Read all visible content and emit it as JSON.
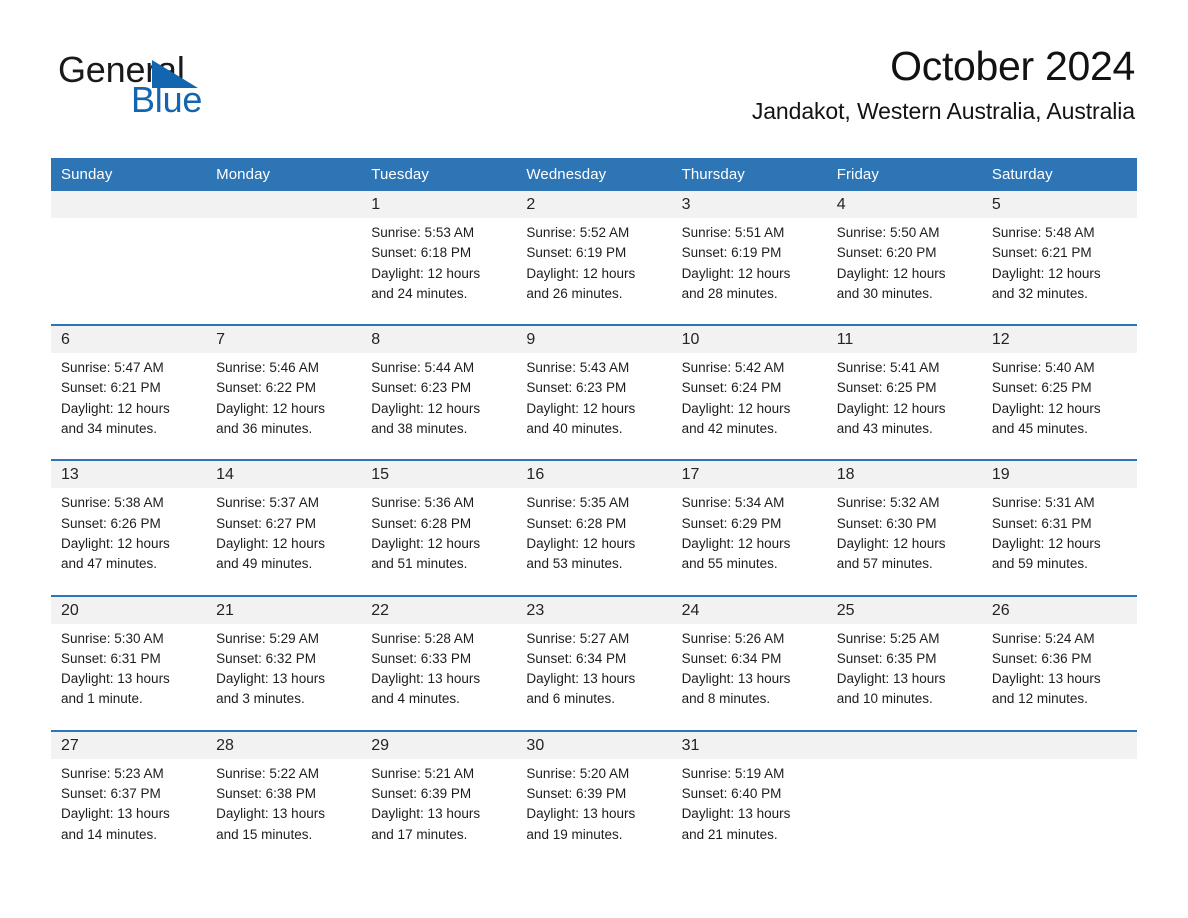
{
  "brand": {
    "name_part1": "General",
    "name_part2": "Blue",
    "triangle_color": "#1266b0",
    "text_color": "#1a1a1a"
  },
  "header": {
    "title": "October 2024",
    "subtitle": "Jandakot, Western Australia, Australia"
  },
  "theme": {
    "header_blue": "#2e75b6",
    "date_band_gray": "#f2f2f2",
    "page_background": "#ffffff",
    "body_text": "#1d1d1d"
  },
  "weekday_headers": [
    "Sunday",
    "Monday",
    "Tuesday",
    "Wednesday",
    "Thursday",
    "Friday",
    "Saturday"
  ],
  "labels": {
    "sunrise_prefix": "Sunrise:",
    "sunset_prefix": "Sunset:",
    "daylight_prefix": "Daylight:"
  },
  "weeks": [
    [
      {
        "day": "",
        "empty": true
      },
      {
        "day": "",
        "empty": true
      },
      {
        "day": "1",
        "sunrise": "Sunrise: 5:53 AM",
        "sunset": "Sunset: 6:18 PM",
        "daylight": "Daylight: 12 hours and 24 minutes."
      },
      {
        "day": "2",
        "sunrise": "Sunrise: 5:52 AM",
        "sunset": "Sunset: 6:19 PM",
        "daylight": "Daylight: 12 hours and 26 minutes."
      },
      {
        "day": "3",
        "sunrise": "Sunrise: 5:51 AM",
        "sunset": "Sunset: 6:19 PM",
        "daylight": "Daylight: 12 hours and 28 minutes."
      },
      {
        "day": "4",
        "sunrise": "Sunrise: 5:50 AM",
        "sunset": "Sunset: 6:20 PM",
        "daylight": "Daylight: 12 hours and 30 minutes."
      },
      {
        "day": "5",
        "sunrise": "Sunrise: 5:48 AM",
        "sunset": "Sunset: 6:21 PM",
        "daylight": "Daylight: 12 hours and 32 minutes."
      }
    ],
    [
      {
        "day": "6",
        "sunrise": "Sunrise: 5:47 AM",
        "sunset": "Sunset: 6:21 PM",
        "daylight": "Daylight: 12 hours and 34 minutes."
      },
      {
        "day": "7",
        "sunrise": "Sunrise: 5:46 AM",
        "sunset": "Sunset: 6:22 PM",
        "daylight": "Daylight: 12 hours and 36 minutes."
      },
      {
        "day": "8",
        "sunrise": "Sunrise: 5:44 AM",
        "sunset": "Sunset: 6:23 PM",
        "daylight": "Daylight: 12 hours and 38 minutes."
      },
      {
        "day": "9",
        "sunrise": "Sunrise: 5:43 AM",
        "sunset": "Sunset: 6:23 PM",
        "daylight": "Daylight: 12 hours and 40 minutes."
      },
      {
        "day": "10",
        "sunrise": "Sunrise: 5:42 AM",
        "sunset": "Sunset: 6:24 PM",
        "daylight": "Daylight: 12 hours and 42 minutes."
      },
      {
        "day": "11",
        "sunrise": "Sunrise: 5:41 AM",
        "sunset": "Sunset: 6:25 PM",
        "daylight": "Daylight: 12 hours and 43 minutes."
      },
      {
        "day": "12",
        "sunrise": "Sunrise: 5:40 AM",
        "sunset": "Sunset: 6:25 PM",
        "daylight": "Daylight: 12 hours and 45 minutes."
      }
    ],
    [
      {
        "day": "13",
        "sunrise": "Sunrise: 5:38 AM",
        "sunset": "Sunset: 6:26 PM",
        "daylight": "Daylight: 12 hours and 47 minutes."
      },
      {
        "day": "14",
        "sunrise": "Sunrise: 5:37 AM",
        "sunset": "Sunset: 6:27 PM",
        "daylight": "Daylight: 12 hours and 49 minutes."
      },
      {
        "day": "15",
        "sunrise": "Sunrise: 5:36 AM",
        "sunset": "Sunset: 6:28 PM",
        "daylight": "Daylight: 12 hours and 51 minutes."
      },
      {
        "day": "16",
        "sunrise": "Sunrise: 5:35 AM",
        "sunset": "Sunset: 6:28 PM",
        "daylight": "Daylight: 12 hours and 53 minutes."
      },
      {
        "day": "17",
        "sunrise": "Sunrise: 5:34 AM",
        "sunset": "Sunset: 6:29 PM",
        "daylight": "Daylight: 12 hours and 55 minutes."
      },
      {
        "day": "18",
        "sunrise": "Sunrise: 5:32 AM",
        "sunset": "Sunset: 6:30 PM",
        "daylight": "Daylight: 12 hours and 57 minutes."
      },
      {
        "day": "19",
        "sunrise": "Sunrise: 5:31 AM",
        "sunset": "Sunset: 6:31 PM",
        "daylight": "Daylight: 12 hours and 59 minutes."
      }
    ],
    [
      {
        "day": "20",
        "sunrise": "Sunrise: 5:30 AM",
        "sunset": "Sunset: 6:31 PM",
        "daylight": "Daylight: 13 hours and 1 minute."
      },
      {
        "day": "21",
        "sunrise": "Sunrise: 5:29 AM",
        "sunset": "Sunset: 6:32 PM",
        "daylight": "Daylight: 13 hours and 3 minutes."
      },
      {
        "day": "22",
        "sunrise": "Sunrise: 5:28 AM",
        "sunset": "Sunset: 6:33 PM",
        "daylight": "Daylight: 13 hours and 4 minutes."
      },
      {
        "day": "23",
        "sunrise": "Sunrise: 5:27 AM",
        "sunset": "Sunset: 6:34 PM",
        "daylight": "Daylight: 13 hours and 6 minutes."
      },
      {
        "day": "24",
        "sunrise": "Sunrise: 5:26 AM",
        "sunset": "Sunset: 6:34 PM",
        "daylight": "Daylight: 13 hours and 8 minutes."
      },
      {
        "day": "25",
        "sunrise": "Sunrise: 5:25 AM",
        "sunset": "Sunset: 6:35 PM",
        "daylight": "Daylight: 13 hours and 10 minutes."
      },
      {
        "day": "26",
        "sunrise": "Sunrise: 5:24 AM",
        "sunset": "Sunset: 6:36 PM",
        "daylight": "Daylight: 13 hours and 12 minutes."
      }
    ],
    [
      {
        "day": "27",
        "sunrise": "Sunrise: 5:23 AM",
        "sunset": "Sunset: 6:37 PM",
        "daylight": "Daylight: 13 hours and 14 minutes."
      },
      {
        "day": "28",
        "sunrise": "Sunrise: 5:22 AM",
        "sunset": "Sunset: 6:38 PM",
        "daylight": "Daylight: 13 hours and 15 minutes."
      },
      {
        "day": "29",
        "sunrise": "Sunrise: 5:21 AM",
        "sunset": "Sunset: 6:39 PM",
        "daylight": "Daylight: 13 hours and 17 minutes."
      },
      {
        "day": "30",
        "sunrise": "Sunrise: 5:20 AM",
        "sunset": "Sunset: 6:39 PM",
        "daylight": "Daylight: 13 hours and 19 minutes."
      },
      {
        "day": "31",
        "sunrise": "Sunrise: 5:19 AM",
        "sunset": "Sunset: 6:40 PM",
        "daylight": "Daylight: 13 hours and 21 minutes."
      },
      {
        "day": "",
        "empty": true
      },
      {
        "day": "",
        "empty": true
      }
    ]
  ]
}
